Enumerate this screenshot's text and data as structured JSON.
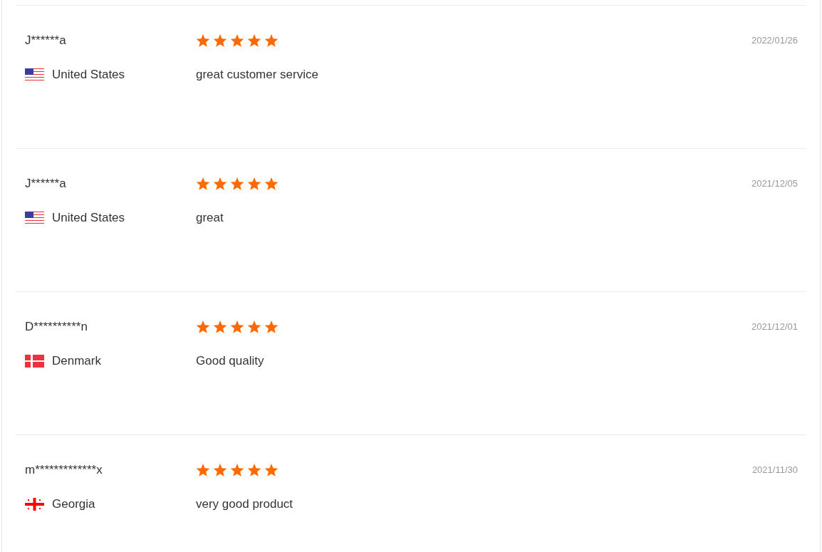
{
  "reviews": [
    {
      "name": "J******a",
      "kind": "us",
      "country": "United States",
      "stars": 5,
      "text": "great customer service",
      "date": "2022/01/26"
    },
    {
      "name": "J******a",
      "kind": "us",
      "country": "United States",
      "stars": 5,
      "text": "great",
      "date": "2021/12/05"
    },
    {
      "name": "D**********n",
      "kind": "dk",
      "country": "Denmark",
      "stars": 5,
      "text": "Good quality",
      "date": "2021/12/01"
    },
    {
      "name": "m*************x",
      "kind": "ge",
      "country": "Georgia",
      "stars": 5,
      "text": "very good product",
      "date": "2021/11/30"
    }
  ]
}
